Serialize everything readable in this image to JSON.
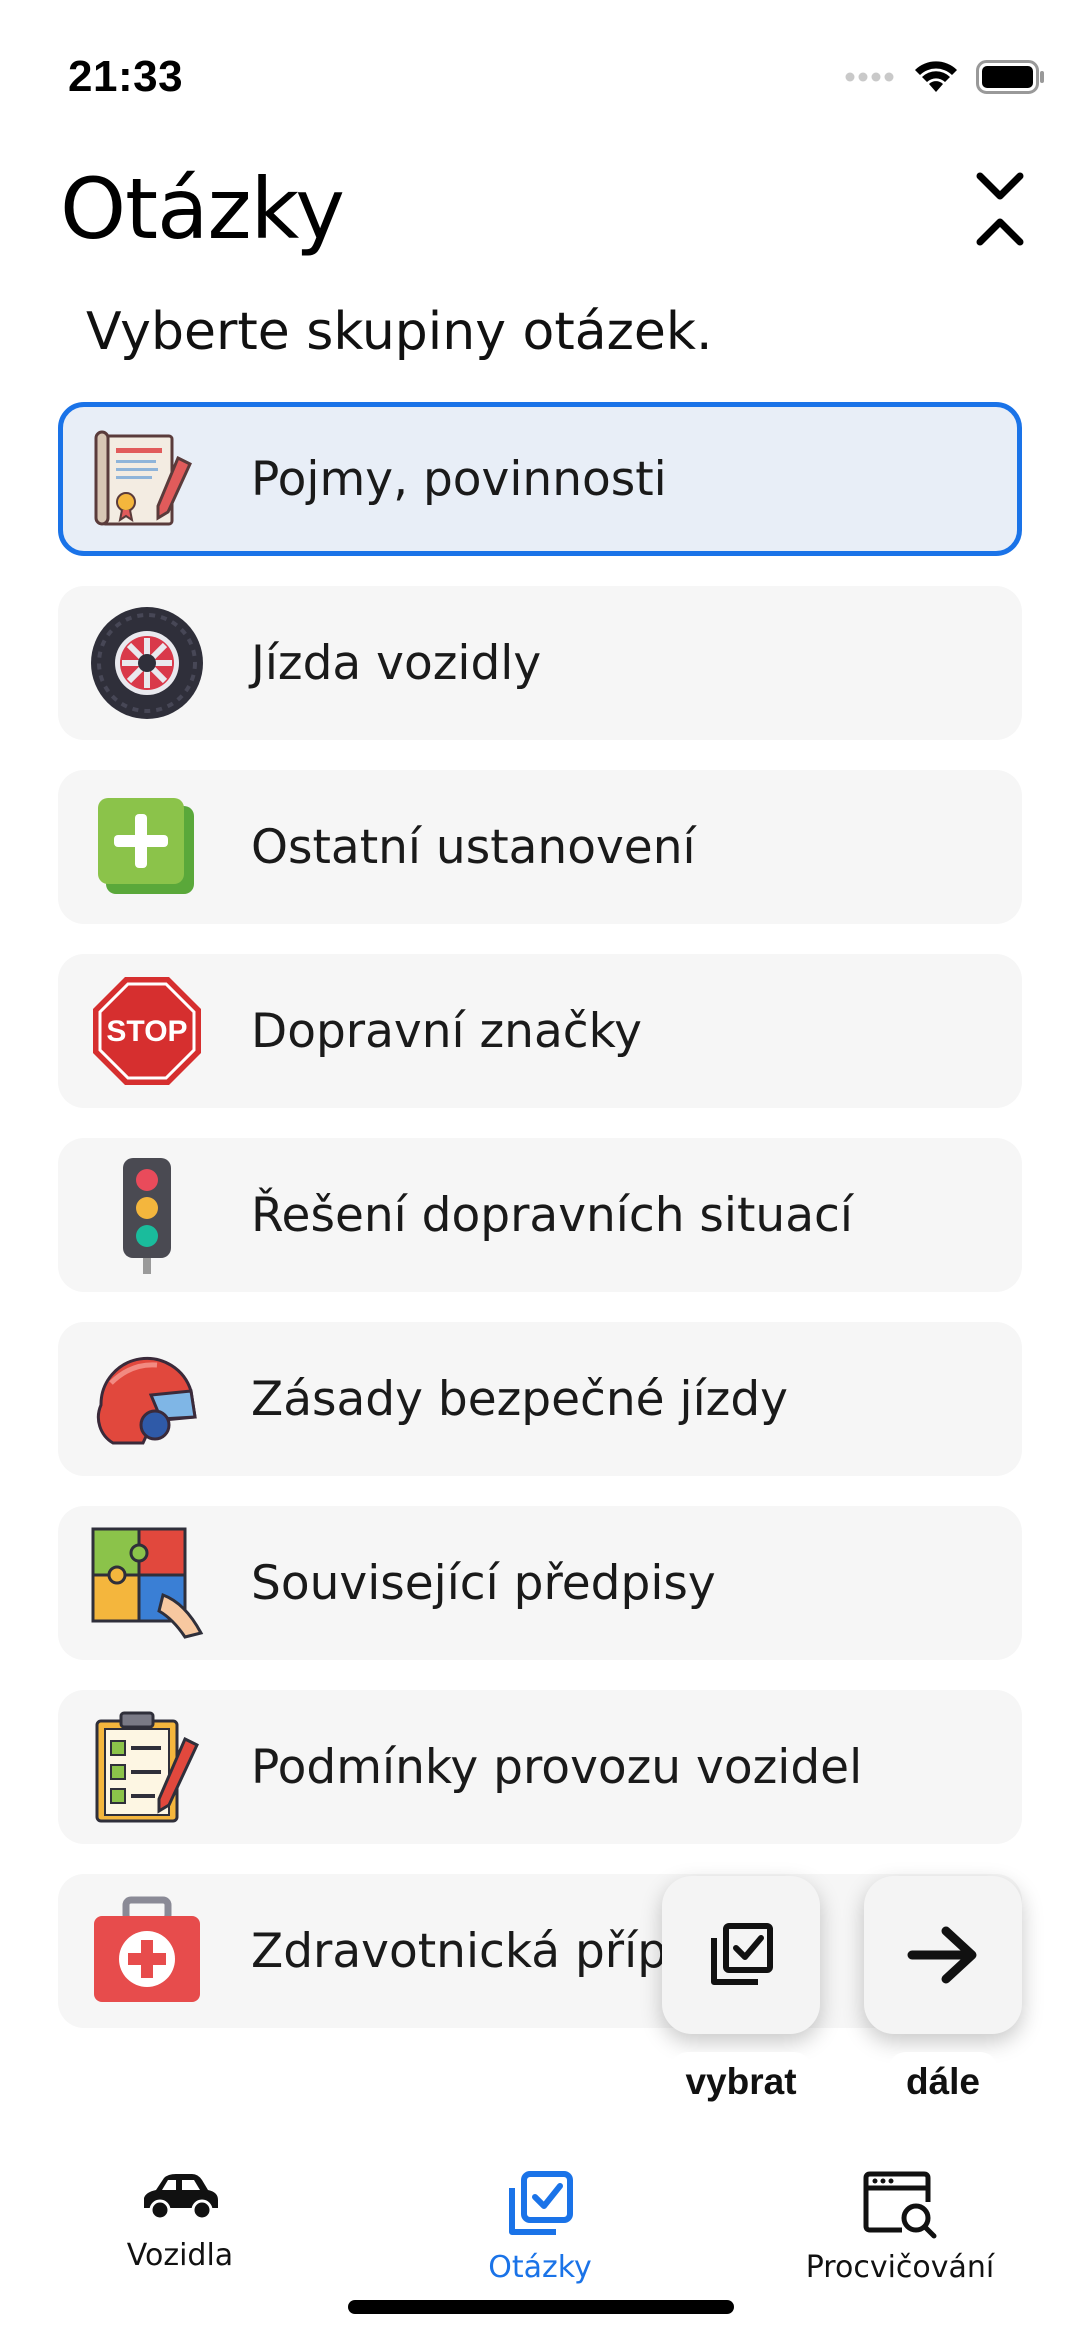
{
  "status": {
    "time": "21:33"
  },
  "header": {
    "title": "Otázky"
  },
  "subtitle": "Vyberte skupiny otázek.",
  "groups": [
    {
      "label": "Pojmy, povinnosti",
      "icon": "certificate-icon",
      "selected": true
    },
    {
      "label": "Jízda vozidly",
      "icon": "tire-icon",
      "selected": false
    },
    {
      "label": "Ostatní ustanovení",
      "icon": "plus-square-icon",
      "selected": false
    },
    {
      "label": "Dopravní značky",
      "icon": "stop-sign-icon",
      "selected": false
    },
    {
      "label": "Řešení dopravních situací",
      "icon": "traffic-light-icon",
      "selected": false
    },
    {
      "label": "Zásady bezpečné jízdy",
      "icon": "helmet-icon",
      "selected": false
    },
    {
      "label": "Související předpisy",
      "icon": "puzzle-icon",
      "selected": false
    },
    {
      "label": "Podmínky provozu vozidel",
      "icon": "checklist-icon",
      "selected": false
    },
    {
      "label": "Zdravotnická příprava",
      "icon": "first-aid-kit-icon",
      "selected": false
    }
  ],
  "actions": {
    "select_label": "vybrat",
    "next_label": "dále"
  },
  "tabs": [
    {
      "label": "Vozidla",
      "icon": "car-icon",
      "active": false
    },
    {
      "label": "Otázky",
      "icon": "checked-stack-icon",
      "active": true
    },
    {
      "label": "Procvičování",
      "icon": "browser-search-icon",
      "active": false
    }
  ],
  "colors": {
    "accent": "#1a73e8",
    "selected_bg": "#e8eef7",
    "item_bg": "#f6f6f6"
  }
}
